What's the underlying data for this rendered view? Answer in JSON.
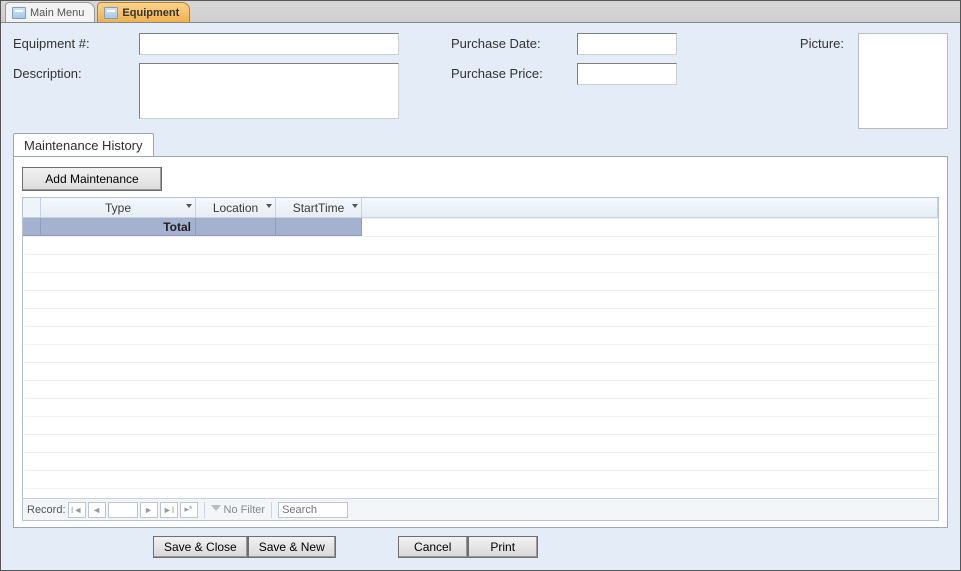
{
  "tabs": {
    "main_menu": "Main Menu",
    "equipment": "Equipment"
  },
  "labels": {
    "equipment_no": "Equipment #:",
    "description": "Description:",
    "purchase_date": "Purchase Date:",
    "purchase_price": "Purchase Price:",
    "picture": "Picture:"
  },
  "fields": {
    "equipment_no": "",
    "description": "",
    "purchase_date": "",
    "purchase_price": ""
  },
  "inner_tab": {
    "title": "Maintenance History",
    "add_button": "Add Maintenance"
  },
  "datasheet": {
    "columns": {
      "type": "Type",
      "location": "Location",
      "start_time": "StartTime"
    },
    "rows": [],
    "total_label": "Total"
  },
  "record_nav": {
    "label": "Record:",
    "current": "",
    "no_filter": "No Filter",
    "search_placeholder": "Search"
  },
  "actions": {
    "save_close": "Save & Close",
    "save_new": "Save & New",
    "cancel": "Cancel",
    "print": "Print"
  }
}
